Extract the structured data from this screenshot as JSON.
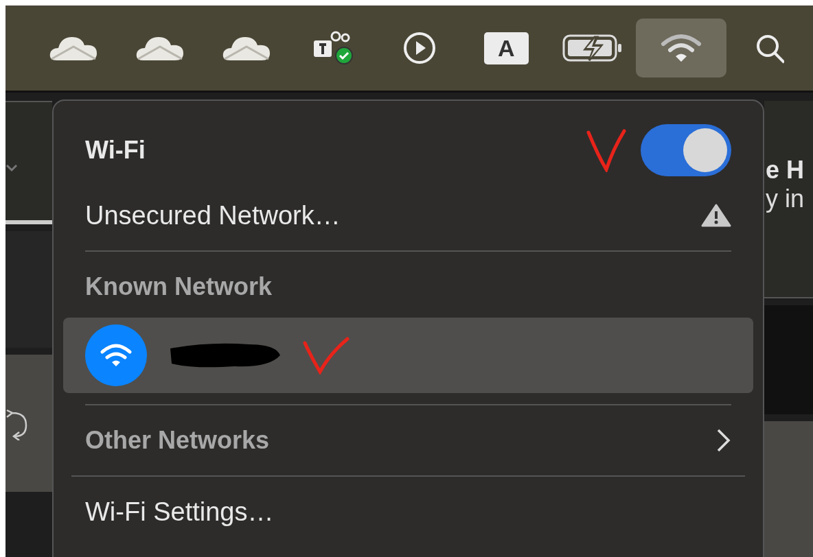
{
  "menu_bar": {
    "icons": [
      {
        "kind": "cloud",
        "selected": false
      },
      {
        "kind": "cloud",
        "selected": false
      },
      {
        "kind": "cloud",
        "selected": false
      },
      {
        "kind": "teams",
        "selected": false
      },
      {
        "kind": "play",
        "selected": false
      },
      {
        "kind": "input",
        "label": "A",
        "selected": false
      },
      {
        "kind": "battery",
        "selected": false
      },
      {
        "kind": "wifi",
        "selected": true
      },
      {
        "kind": "search",
        "selected": false
      }
    ]
  },
  "background": {
    "heading": "e H",
    "line": "y in"
  },
  "wifi_menu": {
    "title": "Wi-Fi",
    "on": true,
    "unsecured": {
      "label": "Unsecured Network…",
      "warning": true
    },
    "known_heading": "Known Network",
    "known_networks": [
      {
        "redacted": true,
        "selected": true
      }
    ],
    "other_networks": {
      "label": "Other Networks",
      "expanded": false
    },
    "settings": "Wi-Fi Settings…"
  }
}
